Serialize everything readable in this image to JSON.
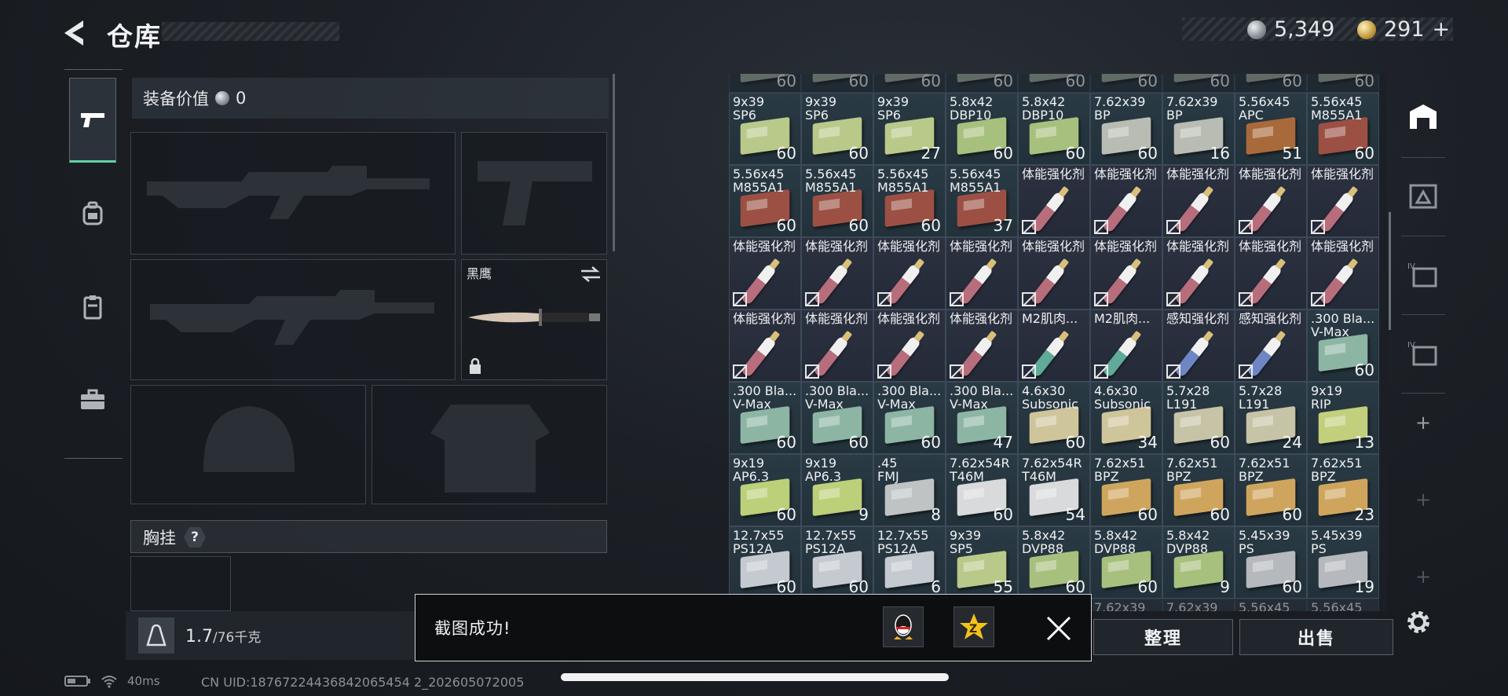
{
  "header": {
    "title": "仓库",
    "currency": {
      "silver": "5,349",
      "gold": "291",
      "gold_add": "+"
    }
  },
  "equipment": {
    "value_label": "装备价值",
    "value": "0",
    "melee_name": "黑鹰",
    "chest_rig_label": "胸挂",
    "chest_rig_help": "?"
  },
  "capacity": {
    "current": "1.7",
    "max": "/76千克"
  },
  "status": {
    "ping": "40ms",
    "uid": "CN UID:18767224436842065454 2_202605072005"
  },
  "toast": {
    "message": "截图成功!"
  },
  "actions": {
    "sort": "整理",
    "sell": "出售"
  },
  "inventory": [
    {
      "label": "9x39\nSP6",
      "qty": "60",
      "kind": "ammo",
      "color": "#b9c98a"
    },
    {
      "label": "9x39\nSP6",
      "qty": "60",
      "kind": "ammo",
      "color": "#b9c98a"
    },
    {
      "label": "9x39\nSP6",
      "qty": "27",
      "kind": "ammo",
      "color": "#b9c98a"
    },
    {
      "label": "5.8x42\nDBP10",
      "qty": "60",
      "kind": "ammo",
      "color": "#a8c07d"
    },
    {
      "label": "5.8x42\nDBP10",
      "qty": "60",
      "kind": "ammo",
      "color": "#a8c07d"
    },
    {
      "label": "7.62x39\nBP",
      "qty": "60",
      "kind": "ammo",
      "color": "#b8bcb2"
    },
    {
      "label": "7.62x39\nBP",
      "qty": "16",
      "kind": "ammo",
      "color": "#b8bcb2"
    },
    {
      "label": "5.56x45\nAPC",
      "qty": "51",
      "kind": "ammo",
      "color": "#a86a3a"
    },
    {
      "label": "5.56x45\nM855A1",
      "qty": "60",
      "kind": "ammo",
      "color": "#9c5044"
    },
    {
      "label": "5.56x45\nM855A1",
      "qty": "60",
      "kind": "ammo",
      "color": "#9c5044"
    },
    {
      "label": "5.56x45\nM855A1",
      "qty": "60",
      "kind": "ammo",
      "color": "#9c5044"
    },
    {
      "label": "5.56x45\nM855A1",
      "qty": "60",
      "kind": "ammo",
      "color": "#9c5044"
    },
    {
      "label": "5.56x45\nM855A1",
      "qty": "37",
      "kind": "ammo",
      "color": "#9c5044"
    },
    {
      "label": "体能强化剂",
      "qty": "",
      "kind": "stim",
      "color": "#b86d7c"
    },
    {
      "label": "体能强化剂",
      "qty": "",
      "kind": "stim",
      "color": "#b86d7c"
    },
    {
      "label": "体能强化剂",
      "qty": "",
      "kind": "stim",
      "color": "#b86d7c"
    },
    {
      "label": "体能强化剂",
      "qty": "",
      "kind": "stim",
      "color": "#b86d7c"
    },
    {
      "label": "体能强化剂",
      "qty": "",
      "kind": "stim",
      "color": "#b86d7c"
    },
    {
      "label": "体能强化剂",
      "qty": "",
      "kind": "stim",
      "color": "#b86d7c"
    },
    {
      "label": "体能强化剂",
      "qty": "",
      "kind": "stim",
      "color": "#b86d7c"
    },
    {
      "label": "体能强化剂",
      "qty": "",
      "kind": "stim",
      "color": "#b86d7c"
    },
    {
      "label": "体能强化剂",
      "qty": "",
      "kind": "stim",
      "color": "#b86d7c"
    },
    {
      "label": "体能强化剂",
      "qty": "",
      "kind": "stim",
      "color": "#b86d7c"
    },
    {
      "label": "体能强化剂",
      "qty": "",
      "kind": "stim",
      "color": "#b86d7c"
    },
    {
      "label": "体能强化剂",
      "qty": "",
      "kind": "stim",
      "color": "#b86d7c"
    },
    {
      "label": "体能强化剂",
      "qty": "",
      "kind": "stim",
      "color": "#b86d7c"
    },
    {
      "label": "体能强化剂",
      "qty": "",
      "kind": "stim",
      "color": "#b86d7c"
    },
    {
      "label": "体能强化剂",
      "qty": "",
      "kind": "stim",
      "color": "#b86d7c"
    },
    {
      "label": "体能强化剂",
      "qty": "",
      "kind": "stim",
      "color": "#b86d7c"
    },
    {
      "label": "体能强化剂",
      "qty": "",
      "kind": "stim",
      "color": "#b86d7c"
    },
    {
      "label": "体能强化剂",
      "qty": "",
      "kind": "stim",
      "color": "#b86d7c"
    },
    {
      "label": "M2肌肉...",
      "qty": "",
      "kind": "stim",
      "color": "#5faa98"
    },
    {
      "label": "M2肌肉...",
      "qty": "",
      "kind": "stim",
      "color": "#5faa98"
    },
    {
      "label": "感知强化剂",
      "qty": "",
      "kind": "stim",
      "color": "#6f86c4"
    },
    {
      "label": "感知强化剂",
      "qty": "",
      "kind": "stim",
      "color": "#6f86c4"
    },
    {
      "label": ".300 Bla...\nV-Max",
      "qty": "60",
      "kind": "ammo",
      "color": "#8db5a4"
    },
    {
      "label": ".300 Bla...\nV-Max",
      "qty": "60",
      "kind": "ammo",
      "color": "#8db5a4"
    },
    {
      "label": ".300 Bla...\nV-Max",
      "qty": "60",
      "kind": "ammo",
      "color": "#8db5a4"
    },
    {
      "label": ".300 Bla...\nV-Max",
      "qty": "60",
      "kind": "ammo",
      "color": "#8db5a4"
    },
    {
      "label": ".300 Bla...\nV-Max",
      "qty": "47",
      "kind": "ammo",
      "color": "#8db5a4"
    },
    {
      "label": "4.6x30\nSubsonic",
      "qty": "60",
      "kind": "ammo",
      "color": "#cfc59a"
    },
    {
      "label": "4.6x30\nSubsonic",
      "qty": "34",
      "kind": "ammo",
      "color": "#cfc59a"
    },
    {
      "label": "5.7x28\nL191",
      "qty": "60",
      "kind": "ammo",
      "color": "#c7c3a6"
    },
    {
      "label": "5.7x28\nL191",
      "qty": "24",
      "kind": "ammo",
      "color": "#c7c3a6"
    },
    {
      "label": "9x19\nRIP",
      "qty": "13",
      "kind": "ammo",
      "color": "#c2cf7c"
    },
    {
      "label": "9x19\nAP6.3",
      "qty": "60",
      "kind": "ammo",
      "color": "#bcd07a"
    },
    {
      "label": "9x19\nAP6.3",
      "qty": "9",
      "kind": "ammo",
      "color": "#bcd07a"
    },
    {
      "label": ".45\nFMJ",
      "qty": "8",
      "kind": "ammo",
      "color": "#bfc3c4"
    },
    {
      "label": "7.62x54R\nT46M",
      "qty": "60",
      "kind": "ammo",
      "color": "#d9dadb"
    },
    {
      "label": "7.62x54R\nT46M",
      "qty": "54",
      "kind": "ammo",
      "color": "#d9dadb"
    },
    {
      "label": "7.62x51\nBPZ",
      "qty": "60",
      "kind": "ammo",
      "color": "#cfa55e"
    },
    {
      "label": "7.62x51\nBPZ",
      "qty": "60",
      "kind": "ammo",
      "color": "#cfa55e"
    },
    {
      "label": "7.62x51\nBPZ",
      "qty": "60",
      "kind": "ammo",
      "color": "#cfa55e"
    },
    {
      "label": "7.62x51\nBPZ",
      "qty": "23",
      "kind": "ammo",
      "color": "#cfa55e"
    },
    {
      "label": "12.7x55\nPS12A",
      "qty": "60",
      "kind": "ammo",
      "color": "#c5cad0"
    },
    {
      "label": "12.7x55\nPS12A",
      "qty": "60",
      "kind": "ammo",
      "color": "#c5cad0"
    },
    {
      "label": "12.7x55\nPS12A",
      "qty": "6",
      "kind": "ammo",
      "color": "#c5cad0"
    },
    {
      "label": "9x39\nSP5",
      "qty": "55",
      "kind": "ammo",
      "color": "#b9c98a"
    },
    {
      "label": "5.8x42\nDVP88",
      "qty": "60",
      "kind": "ammo",
      "color": "#a8c07d"
    },
    {
      "label": "5.8x42\nDVP88",
      "qty": "60",
      "kind": "ammo",
      "color": "#a8c07d"
    },
    {
      "label": "5.8x42\nDVP88",
      "qty": "9",
      "kind": "ammo",
      "color": "#a8c07d"
    },
    {
      "label": "5.45x39\nPS",
      "qty": "60",
      "kind": "ammo",
      "color": "#b5b9bd"
    },
    {
      "label": "5.45x39\nPS",
      "qty": "19",
      "kind": "ammo",
      "color": "#b5b9bd"
    }
  ],
  "inventory_partial_top": [
    {
      "label": "",
      "qty": "60"
    },
    {
      "label": "",
      "qty": "60"
    },
    {
      "label": "",
      "qty": "60"
    },
    {
      "label": "",
      "qty": "60"
    },
    {
      "label": "",
      "qty": "60"
    },
    {
      "label": "",
      "qty": "60"
    },
    {
      "label": "",
      "qty": "60"
    },
    {
      "label": "",
      "qty": "60"
    },
    {
      "label": "",
      "qty": "60"
    }
  ],
  "inventory_partial_bottom": [
    {
      "label": ""
    },
    {
      "label": ""
    },
    {
      "label": ""
    },
    {
      "label": ""
    },
    {
      "label": ""
    },
    {
      "label": "7.62x39"
    },
    {
      "label": "7.62x39"
    },
    {
      "label": "5.56x45"
    },
    {
      "label": "5.56x45"
    }
  ]
}
